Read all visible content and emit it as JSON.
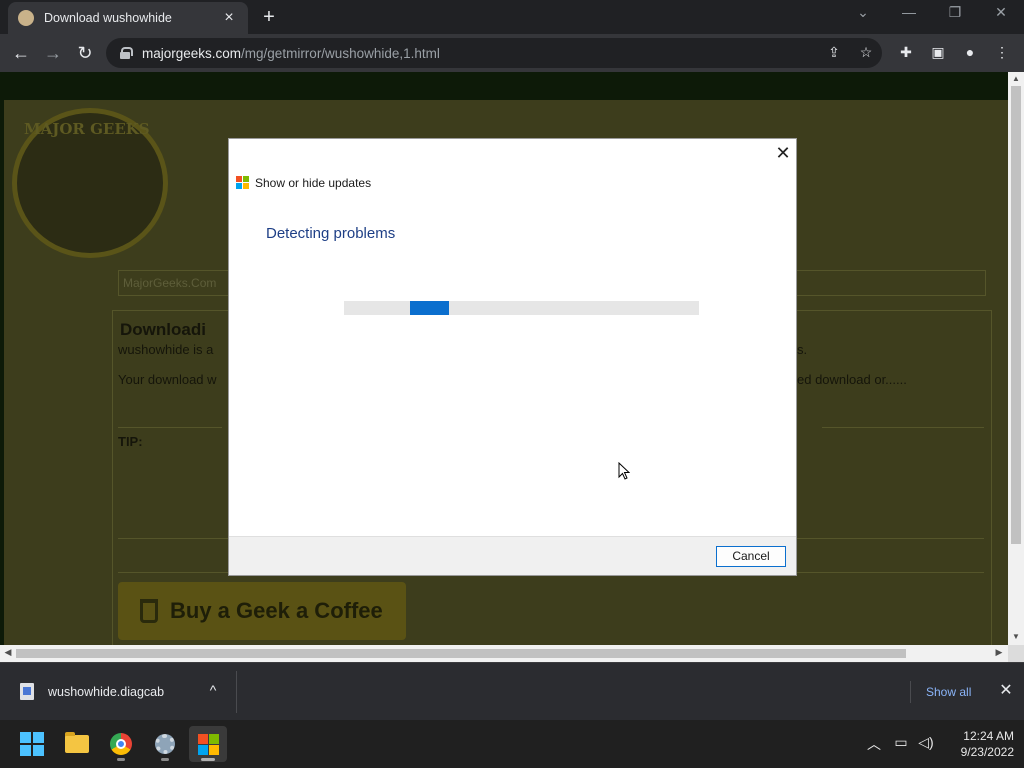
{
  "browser": {
    "tab_title": "Download wushowhide",
    "tab_close": "×",
    "new_tab": "+",
    "window_controls": {
      "tab_search": "⌄",
      "minimize": "—",
      "restore": "❐",
      "close": "✕"
    },
    "nav": {
      "back": "←",
      "forward": "→",
      "reload": "↻"
    },
    "url_host": "majorgeeks.com",
    "url_path": "/mg/getmirror/wushowhide,1.html",
    "omnibox_icons": [
      "share-icon",
      "star-icon"
    ],
    "toolbar_icons": [
      "extensions-icon",
      "side-panel-icon",
      "profile-icon",
      "menu-icon"
    ]
  },
  "page": {
    "logo_text": "MAJOR GEEKS",
    "search_placeholder": "MajorGeeks.Com",
    "heading": "Downloadi",
    "line1_left": "wushowhide is a",
    "line1_right": "s.",
    "line2_left": "Your download w",
    "line2_right": "ed download or......",
    "tip": "TIP:",
    "coffee_label": "Buy a Geek a Coffee"
  },
  "dialog": {
    "title": "Show or hide updates",
    "heading": "Detecting problems",
    "close": "✕",
    "cancel_label": "Cancel",
    "progress": {
      "start": 0.187,
      "width": 0.11
    },
    "accent": "#0b6fce"
  },
  "download_shelf": {
    "file_name": "wushowhide.diagcab",
    "caret": "^",
    "show_all": "Show all",
    "close": "✕"
  },
  "taskbar": {
    "apps": [
      "start-icon",
      "file-explorer-icon",
      "chrome-icon",
      "settings-icon",
      "troubleshooter-icon"
    ],
    "tray_icons": [
      "chevron-up-icon",
      "network-icon",
      "volume-icon"
    ],
    "time": "12:24 AM",
    "date": "9/23/2022"
  }
}
